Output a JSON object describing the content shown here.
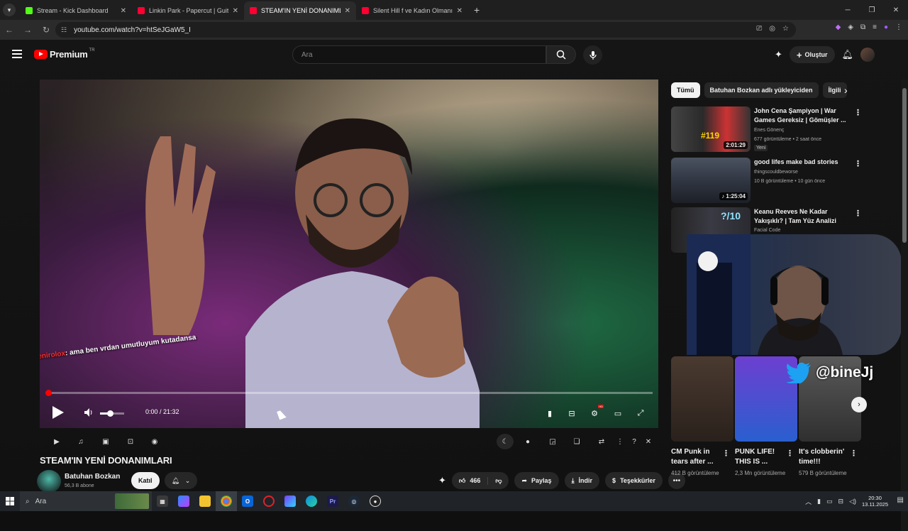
{
  "browser": {
    "tabs": [
      {
        "title": "Stream - Kick Dashboard",
        "color": "#53fc18",
        "active": false
      },
      {
        "title": "Linkin Park - Papercut | Guitar Cover",
        "color": "#ff0033",
        "active": false
      },
      {
        "title": "STEAM'IN YENİ DONANIMLARI",
        "color": "#ff0033",
        "active": true
      },
      {
        "title": "Silent Hill f ve Kadın Olmanın Korkusu",
        "color": "#ff0033",
        "active": false
      }
    ],
    "url": "youtube.com/watch?v=htSeJGaW5_I"
  },
  "youtube": {
    "logo_text": "Premium",
    "logo_region": "TR",
    "search_placeholder": "Ara",
    "create_label": "Oluştur"
  },
  "player": {
    "chat_user": "Xenirolox",
    "chat_message": ": ama ben vrdan umutluyum kutadansa",
    "time": "0:00 / 21:32",
    "progress": 0.004,
    "volume": 0.35,
    "hd_badge": "HD"
  },
  "video": {
    "title": "STEAM'IN YENİ DONANIMLARI",
    "channel": "Batuhan Bozkan",
    "subscribers": "56,3 B abone",
    "join_label": "Katıl",
    "likes": "466",
    "share_label": "Paylaş",
    "download_label": "İndir",
    "thanks_label": "Teşekkürler"
  },
  "sidebar": {
    "chips": [
      "Tümü",
      "Batuhan Bozkan adlı yükleyiciden",
      "İlgili"
    ],
    "recommendations": [
      {
        "title": "John Cena Şampiyon | War Games Gereksiz | Gömüşler ...",
        "channel": "Enes Gönenç",
        "meta": "677 görüntüleme • 2 saat önce",
        "duration": "2:01:29",
        "badge": "Yeni",
        "thumb_overlay": "#119"
      },
      {
        "title": "good lifes make bad stories",
        "channel": "thingscouldbeworse",
        "meta": "10 B görüntüleme • 10 gün önce",
        "duration": "♪ 1:25:04"
      },
      {
        "title": "Keanu Reeves Ne Kadar Yakışıklı? | Tam Yüz Analizi",
        "channel": "Facial Code",
        "meta": "",
        "duration": "",
        "thumb_overlay": "?/10"
      }
    ],
    "shorts": [
      {
        "title": "CM Punk in tears after ...",
        "views": "412 B görüntüleme"
      },
      {
        "title": "PUNK LIFE! THIS IS ...",
        "views": "2,3 Mn görüntüleme"
      },
      {
        "title": "It's clobberin' time!!!",
        "views": "579 B görüntüleme"
      }
    ],
    "twitter_handle": "@bineJj"
  },
  "taskbar": {
    "search_label": "Ara",
    "time": "20:30",
    "date": "13.11.2025"
  }
}
